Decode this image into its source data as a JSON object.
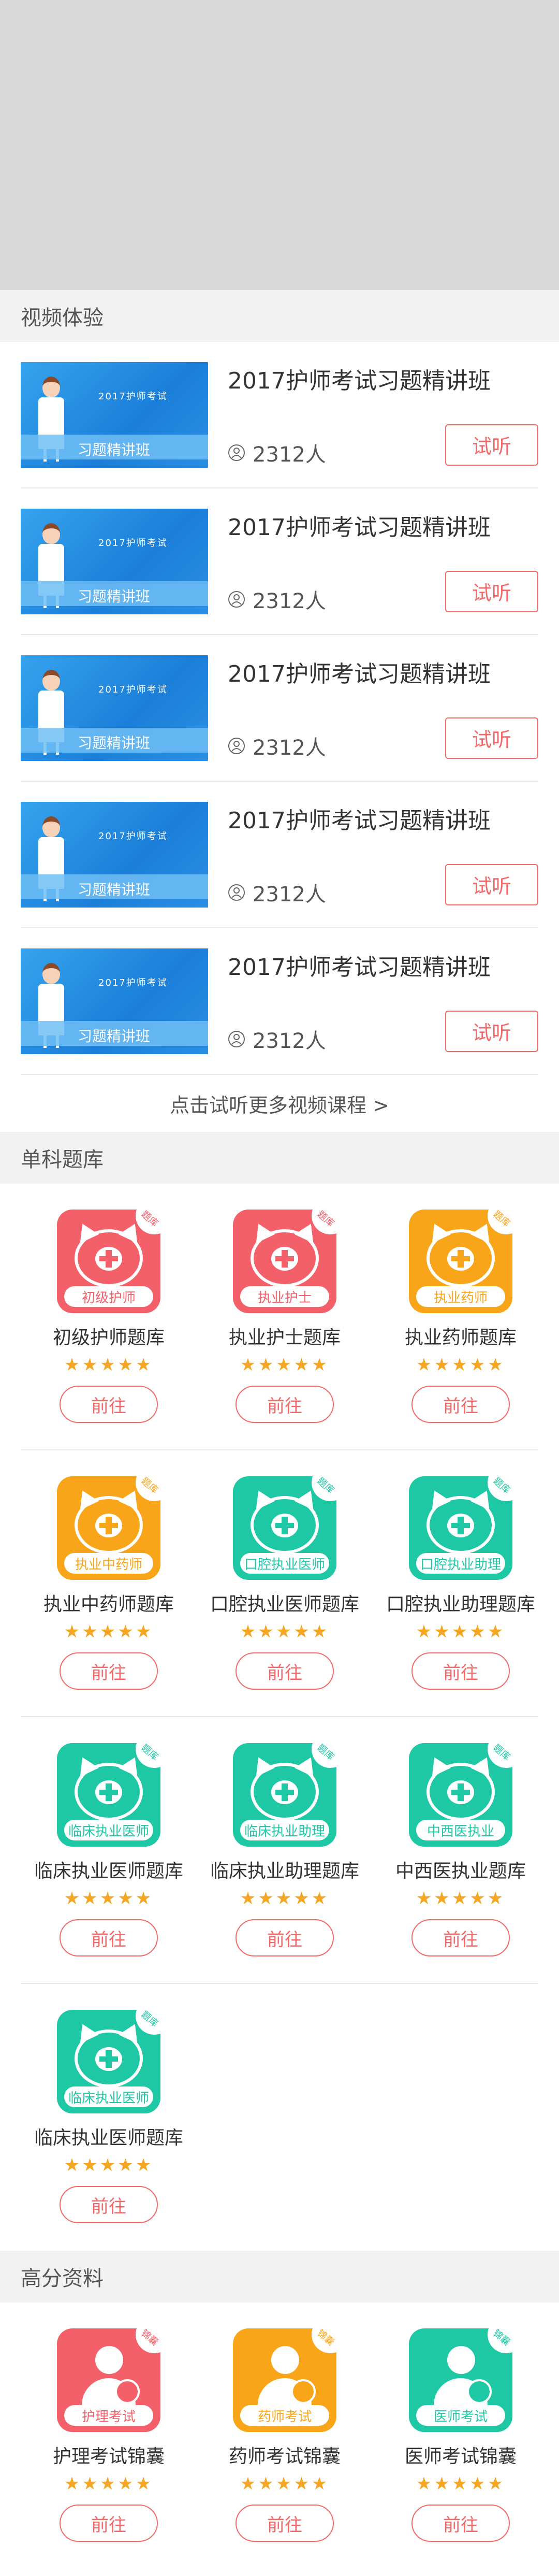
{
  "video_section": {
    "title": "视频体验",
    "thumb_top": "2017护师考试",
    "thumb_label": "习题精讲班",
    "items": [
      {
        "title": "2017护师考试习题精讲班",
        "count": "2312人",
        "button": "试听"
      },
      {
        "title": "2017护师考试习题精讲班",
        "count": "2312人",
        "button": "试听"
      },
      {
        "title": "2017护师考试习题精讲班",
        "count": "2312人",
        "button": "试听"
      },
      {
        "title": "2017护师考试习题精讲班",
        "count": "2312人",
        "button": "试听"
      },
      {
        "title": "2017护师考试习题精讲班",
        "count": "2312人",
        "button": "试听"
      }
    ],
    "more": "点击试听更多视频课程 >"
  },
  "bank_section": {
    "title": "单科题库",
    "corner": "题库",
    "stars": "★★★★★",
    "button": "前往",
    "items": [
      {
        "label": "初级护师",
        "name": "初级护师题库",
        "color": "#f4606a"
      },
      {
        "label": "执业护士",
        "name": "执业护士题库",
        "color": "#f4606a"
      },
      {
        "label": "执业药师",
        "name": "执业药师题库",
        "color": "#f9a51a"
      },
      {
        "label": "执业中药师",
        "name": "执业中药师题库",
        "color": "#f9a51a"
      },
      {
        "label": "口腔执业医师",
        "name": "口腔执业医师题库",
        "color": "#1ec8a5"
      },
      {
        "label": "口腔执业助理",
        "name": "口腔执业助理题库",
        "color": "#1ec8a5"
      },
      {
        "label": "临床执业医师",
        "name": "临床执业医师题库",
        "color": "#1ec8a5"
      },
      {
        "label": "临床执业助理",
        "name": "临床执业助理题库",
        "color": "#1ec8a5"
      },
      {
        "label": "中西医执业",
        "name": "中西医执业题库",
        "color": "#1ec8a5"
      },
      {
        "label": "临床执业医师",
        "name": "临床执业医师题库",
        "color": "#1ec8a5"
      }
    ]
  },
  "material_section": {
    "title": "高分资料",
    "corner": "锦囊",
    "stars": "★★★★★",
    "button": "前往",
    "items": [
      {
        "label": "护理考试",
        "name": "护理考试锦囊",
        "color": "#f4606a"
      },
      {
        "label": "药师考试",
        "name": "药师考试锦囊",
        "color": "#f9a51a"
      },
      {
        "label": "医师考试",
        "name": "医师考试锦囊",
        "color": "#1ec8a5"
      }
    ]
  }
}
